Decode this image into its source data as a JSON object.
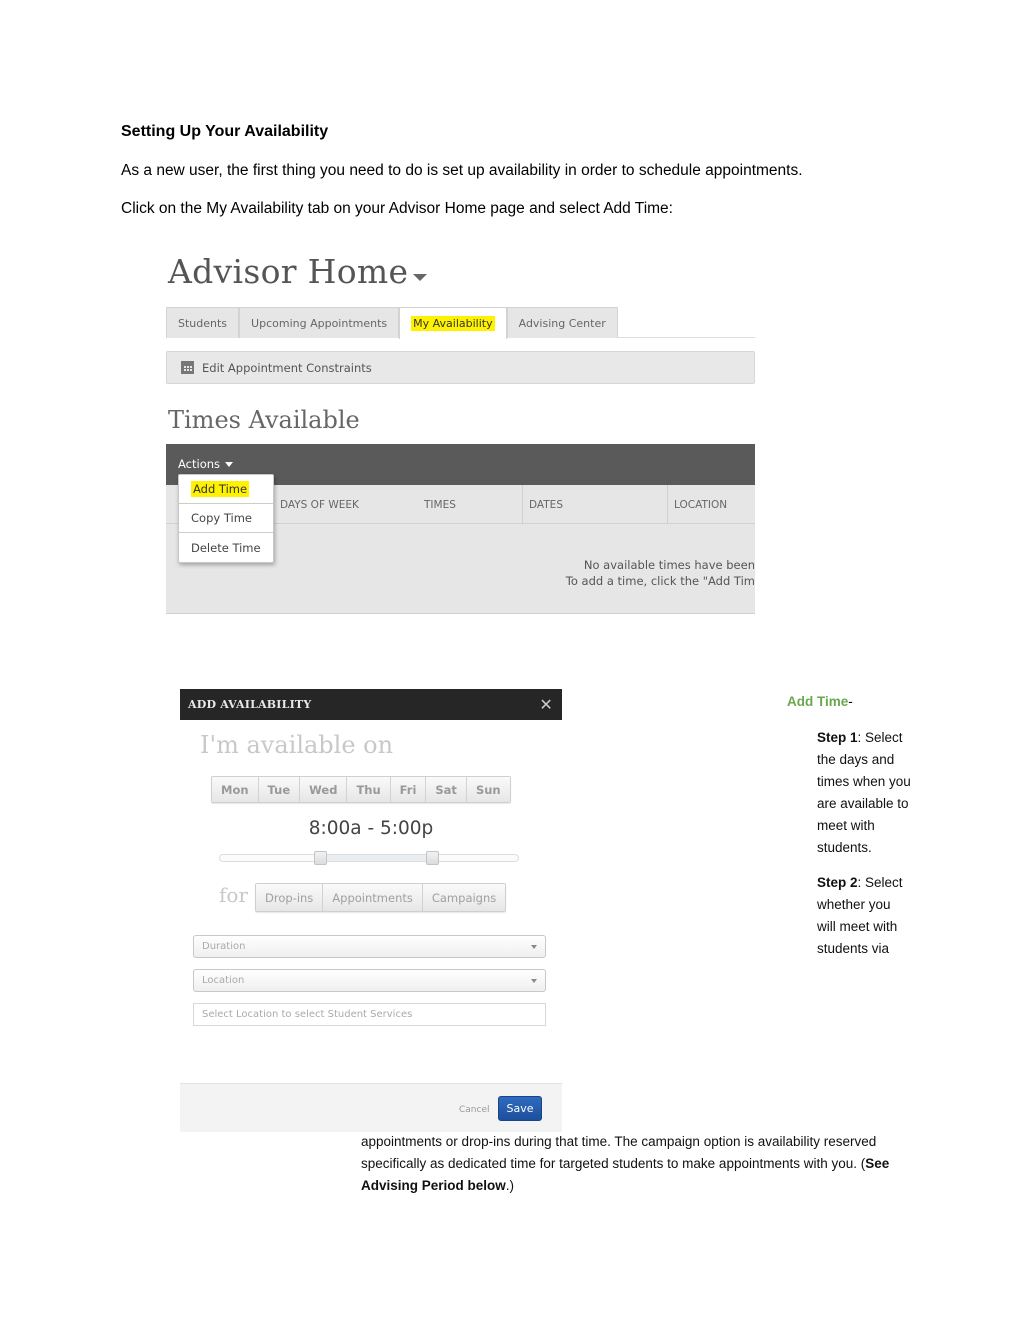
{
  "document": {
    "heading": "Setting Up Your Availability",
    "para1": "As a new user, the first thing you need to do is set up availability in order to schedule appointments.",
    "para2": "Click on the My Availability tab on your Advisor Home page and select Add Time:"
  },
  "advisor_home": {
    "title": "Advisor Home",
    "tabs": [
      {
        "label": "Students",
        "active": false
      },
      {
        "label": "Upcoming Appointments",
        "active": false
      },
      {
        "label": "My Availability",
        "active": true,
        "highlighted": true
      },
      {
        "label": "Advising Center",
        "active": false
      }
    ],
    "constraints_button": "Edit Appointment Constraints",
    "times_title": "Times Available",
    "actions_label": "Actions",
    "actions_menu": [
      {
        "label": "Add Time",
        "highlighted": true
      },
      {
        "label": "Copy Time",
        "highlighted": false
      },
      {
        "label": "Delete Time",
        "highlighted": false
      }
    ],
    "columns": [
      "DAYS OF WEEK",
      "TIMES",
      "DATES",
      "LOCATION"
    ],
    "empty_line1": "No available times have been",
    "empty_line2": "To add a time, click the \"Add Tim"
  },
  "modal": {
    "title": "ADD AVAILABILITY",
    "close_icon": "close-icon",
    "heading": "I'm available on",
    "days": [
      "Mon",
      "Tue",
      "Wed",
      "Thu",
      "Fri",
      "Sat",
      "Sun"
    ],
    "time_range": "8:00a - 5:00p",
    "slider": {
      "start_fraction": 0.337,
      "end_fraction": 0.71
    },
    "for_label": "for",
    "types": [
      "Drop-ins",
      "Appointments",
      "Campaigns"
    ],
    "duration_placeholder": "Duration",
    "location_placeholder": "Location",
    "services_placeholder": "Select Location to select Student Services",
    "cancel_label": "Cancel",
    "save_label": "Save"
  },
  "instructions": {
    "add_time_label": "Add Time",
    "add_time_suffix": "-",
    "step1_label": "Step 1",
    "step1_text": ": Select the days and times when you are available to meet with students.",
    "step2_label": "Step 2",
    "step2_text": ": Select whether you will meet with students via",
    "continuation": "appointments or drop-ins during that time. The campaign option is availability reserved specifically as dedicated time for targeted students to make appointments with you.",
    "see_open": "(",
    "see_bold": "See Advising Period below",
    "see_close": ".)"
  },
  "colors": {
    "highlight": "#fff200",
    "accent_green": "#6aa84f",
    "save_blue": "#1d4f9c",
    "modal_header": "#262626",
    "actions_bar": "#5a5a5a"
  }
}
